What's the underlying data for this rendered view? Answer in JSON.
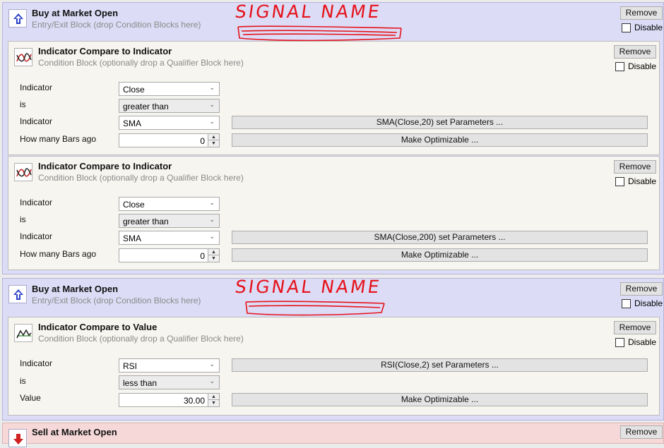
{
  "signal_annotation": "SIGNAL NAME",
  "blocks": [
    {
      "title": "Buy at Market Open",
      "subtitle": "Entry/Exit Block (drop Condition Blocks here)",
      "remove_label": "Remove",
      "disable_label": "Disable",
      "icon": "up-arrow-icon",
      "conditions": [
        {
          "title": "Indicator Compare to Indicator",
          "subtitle": "Condition Block (optionally drop a Qualifier Block here)",
          "remove_label": "Remove",
          "disable_label": "Disable",
          "icon": "indicator-cross-icon",
          "row_labels": [
            "Indicator",
            "is",
            "Indicator",
            "How many Bars ago"
          ],
          "indicator1": "Close",
          "operator": "greater than",
          "indicator2": "SMA",
          "bars_ago": "0",
          "params_button": "SMA(Close,20) set Parameters ...",
          "optimize_button": "Make Optimizable ..."
        },
        {
          "title": "Indicator Compare to Indicator",
          "subtitle": "Condition Block (optionally drop a Qualifier Block here)",
          "remove_label": "Remove",
          "disable_label": "Disable",
          "icon": "indicator-cross-icon",
          "row_labels": [
            "Indicator",
            "is",
            "Indicator",
            "How many Bars ago"
          ],
          "indicator1": "Close",
          "operator": "greater than",
          "indicator2": "SMA",
          "bars_ago": "0",
          "params_button": "SMA(Close,200) set Parameters ...",
          "optimize_button": "Make Optimizable ..."
        }
      ]
    },
    {
      "title": "Buy at Market Open",
      "subtitle": "Entry/Exit Block (drop Condition Blocks here)",
      "remove_label": "Remove",
      "disable_label": "Disable",
      "icon": "up-arrow-icon",
      "conditions": [
        {
          "title": "Indicator Compare to Value",
          "subtitle": "Condition Block (optionally drop a Qualifier Block here)",
          "remove_label": "Remove",
          "disable_label": "Disable",
          "icon": "indicator-wave-icon",
          "row_labels": [
            "Indicator",
            "is",
            "Value"
          ],
          "indicator": "RSI",
          "operator": "less than",
          "value": "30.00",
          "params_button": "RSI(Close,2) set Parameters ...",
          "optimize_button": "Make Optimizable ..."
        }
      ]
    },
    {
      "title": "Sell at Market Open",
      "remove_label": "Remove",
      "icon": "down-arrow-icon"
    }
  ],
  "colors": {
    "entry_bg": "#dcdcf6",
    "sell_bg": "#f6d8d8",
    "condition_bg": "#f7f5ef",
    "annotation": "#e6121a"
  }
}
